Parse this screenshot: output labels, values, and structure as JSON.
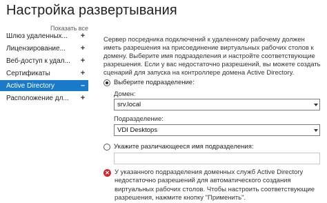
{
  "title": "Настройка развертывания",
  "sidebar": {
    "show_all": "Показать все",
    "items": [
      {
        "label": "Шлюз удаленных...",
        "marker": "+"
      },
      {
        "label": "Лицензирование...",
        "marker": "+"
      },
      {
        "label": "Веб-доступ к удал...",
        "marker": "+"
      },
      {
        "label": "Сертификаты",
        "marker": "+"
      },
      {
        "label": "Active Directory",
        "marker": "–"
      },
      {
        "label": "Расположение дл...",
        "marker": "+"
      }
    ]
  },
  "main": {
    "description": "Сервер посредника подключений к удаленному рабочему должен иметь разрешения на присоединение виртуальных рабочих столов к домену. Выберите имя подразделения и настройте соответствующие разрешения. Если у вас недостаточно разрешений, вы можете создать сценарий для запуска на контроллере домена Active Directory.",
    "option_select": "Выберите подразделение:",
    "domain_label": "Домен:",
    "domain_value": "srv.local",
    "ou_label": "Подразделение:",
    "ou_value": "VDI Desktops",
    "option_custom": "Укажите различающееся имя подразделения:",
    "custom_ou_value": "",
    "error_text": "У указанного подразделения доменных служб Active Directory недостаточно разрешений для автоматического создания виртуальных рабочих столов. Чтобы настроить соответствующие разрешения, нажмите кнопку \"Применить\"."
  }
}
